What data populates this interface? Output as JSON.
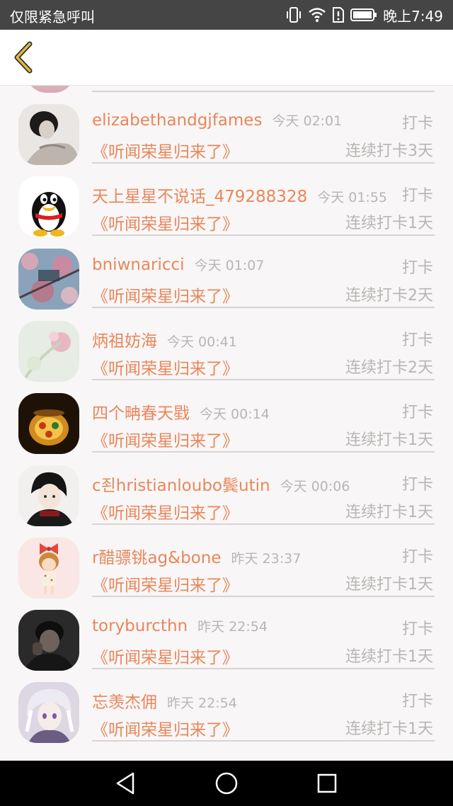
{
  "status_bar": {
    "carrier": "仅限紧急呼叫",
    "time": "晚上7:49",
    "icons": [
      "vibrate-icon",
      "wifi-icon",
      "sim-alert-icon",
      "battery-icon"
    ]
  },
  "header": {
    "back_icon": "chevron-left-icon",
    "accent_color": "#e2b83c"
  },
  "colors": {
    "accent": "#e8875b",
    "muted": "#b9b5b5",
    "divider": "#d8d4d4"
  },
  "entries": [
    {
      "name": "elizabethandgjfames",
      "time": "今天 02:01",
      "action": "打卡",
      "book": "《听闻荣星归来了》",
      "streak": "连续打卡3天"
    },
    {
      "name": "天上星星不说话_479288328",
      "time": "今天 01:55",
      "action": "打卡",
      "book": "《听闻荣星归来了》",
      "streak": "连续打卡1天"
    },
    {
      "name": "bniwnaricci",
      "time": "今天 01:07",
      "action": "打卡",
      "book": "《听闻荣星归来了》",
      "streak": "连续打卡2天"
    },
    {
      "name": "炳祖妨海",
      "time": "今天 00:41",
      "action": "打卡",
      "book": "《听闻荣星归来了》",
      "streak": "连续打卡2天"
    },
    {
      "name": "四个畘春天戥",
      "time": "今天 00:14",
      "action": "打卡",
      "book": "《听闻荣星归来了》",
      "streak": "连续打卡1天"
    },
    {
      "name": "c죈hristianloubo鬓utin",
      "time": "今天 00:06",
      "action": "打卡",
      "book": "《听闻荣星归来了》",
      "streak": "连续打卡1天"
    },
    {
      "name": "r醋骠铫ag&bone",
      "time": "昨天 23:37",
      "action": "打卡",
      "book": "《听闻荣星归来了》",
      "streak": "连续打卡1天"
    },
    {
      "name": "toryburcthn",
      "time": "昨天 22:54",
      "action": "打卡",
      "book": "《听闻荣星归来了》",
      "streak": "连续打卡1天"
    },
    {
      "name": "忘羡杰佣",
      "time": "昨天 22:54",
      "action": "打卡",
      "book": "《听闻荣星归来了》",
      "streak": "连续打卡1天"
    }
  ],
  "nav": {
    "icons": [
      "back-triangle-icon",
      "home-circle-icon",
      "recents-square-icon"
    ]
  }
}
